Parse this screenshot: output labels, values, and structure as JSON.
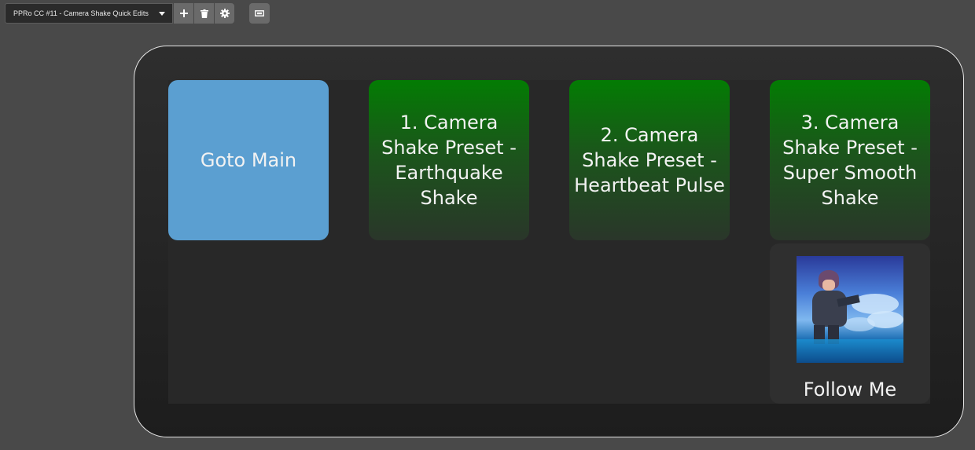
{
  "toolbar": {
    "profile_name": "PPRo CC #11 - Camera Shake Quick Edits",
    "icons": [
      "chevron-down-icon",
      "plus-icon",
      "trash-icon",
      "gear-icon",
      "fit-screen-icon"
    ]
  },
  "keys": [
    {
      "label": "Goto Main",
      "color": "#5b9fd1"
    },
    {
      "label": "1. Camera Shake Preset - Earthquake Shake",
      "color": "#037c03"
    },
    {
      "label": "2. Camera Shake Preset - Heartbeat Pulse",
      "color": "#037c03"
    },
    {
      "label": "3. Camera Shake Preset - Super Smooth Shake",
      "color": "#037c03"
    },
    {
      "label": "Follow Me",
      "image": "anime-character-thumbnail"
    }
  ],
  "colors": {
    "background": "#494949",
    "accent_blue": "#5b9fd1",
    "accent_green": "#037c03"
  }
}
